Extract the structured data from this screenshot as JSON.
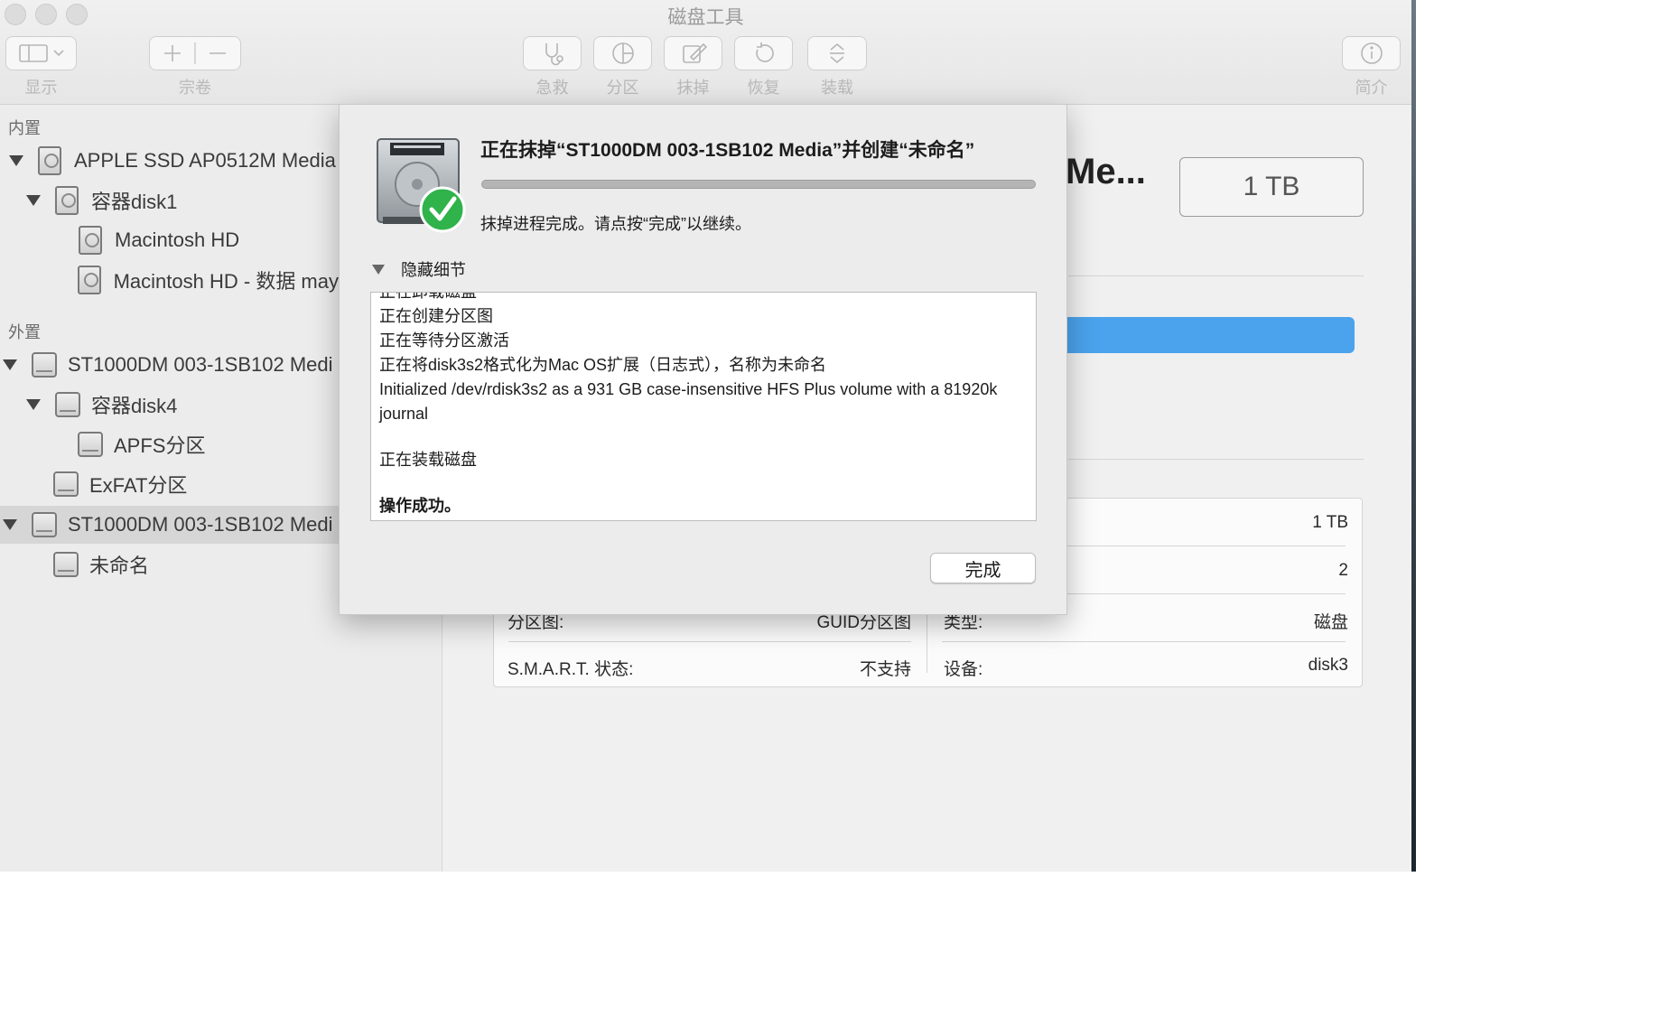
{
  "window": {
    "title": "磁盘工具"
  },
  "toolbar": {
    "view_label": "显示",
    "volume_label": "宗卷",
    "first_aid_label": "急救",
    "partition_label": "分区",
    "erase_label": "抹掉",
    "restore_label": "恢复",
    "mount_label": "装载",
    "info_label": "简介"
  },
  "sidebar": {
    "internal_header": "内置",
    "external_header": "外置",
    "items": [
      {
        "label": "APPLE SSD AP0512M Media"
      },
      {
        "label": "容器disk1"
      },
      {
        "label": "Macintosh HD"
      },
      {
        "label": "Macintosh HD - 数据 may"
      },
      {
        "label": "ST1000DM 003-1SB102 Medi"
      },
      {
        "label": "容器disk4"
      },
      {
        "label": "APFS分区"
      },
      {
        "label": "ExFAT分区"
      },
      {
        "label": "ST1000DM 003-1SB102 Medi"
      },
      {
        "label": "未命名"
      }
    ]
  },
  "main": {
    "title_fragment": "Me...",
    "capacity": "1 TB",
    "table": {
      "row1_right_value": "1 TB",
      "row2_right_value": "2",
      "partition_map_label": "分区图:",
      "partition_map_value": "GUID分区图",
      "type_label": "类型:",
      "type_value": "磁盘",
      "smart_label": "S.M.A.R.T. 状态:",
      "smart_value": "不支持",
      "device_label": "设备:",
      "device_value": "disk3"
    }
  },
  "dialog": {
    "title": "正在抹掉“ST1000DM 003-1SB102 Media”并创建“未命名”",
    "progress": 1.0,
    "message": "抹掉进程完成。请点按“完成”以继续。",
    "details_toggle": "隐藏细节",
    "log": [
      "正在卸载磁盘",
      "正在创建分区图",
      "正在等待分区激活",
      "正在将disk3s2格式化为Mac OS扩展（日志式），名称为未命名",
      "Initialized /dev/rdisk3s2 as a 931 GB case-insensitive HFS Plus volume with a 81920k journal",
      "",
      "正在装载磁盘",
      "",
      "操作成功。"
    ],
    "done_button": "完成"
  },
  "colors": {
    "usage_bar": "#4aa3ec",
    "check_green": "#2fb34a"
  }
}
